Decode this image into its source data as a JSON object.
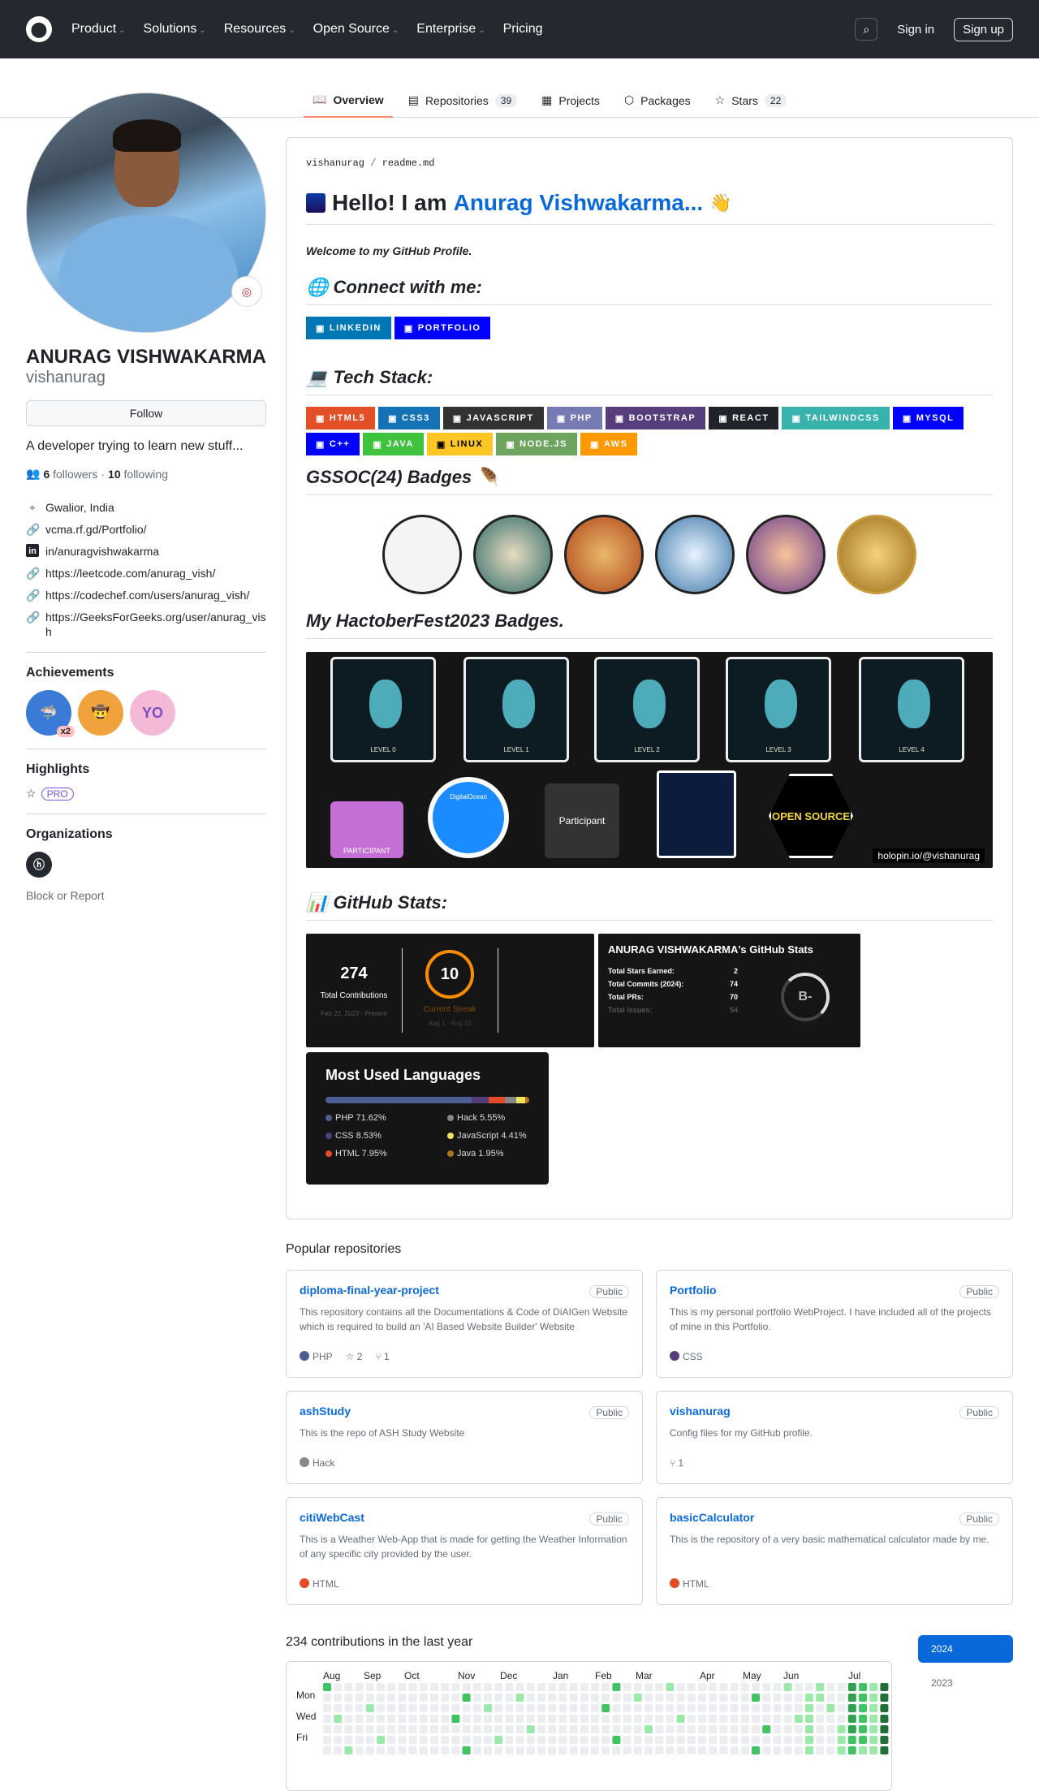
{
  "header": {
    "nav": [
      "Product",
      "Solutions",
      "Resources",
      "Open Source",
      "Enterprise",
      "Pricing"
    ],
    "signin": "Sign in",
    "signup": "Sign up"
  },
  "tabs": [
    {
      "label": "Overview"
    },
    {
      "label": "Repositories",
      "count": "39"
    },
    {
      "label": "Projects"
    },
    {
      "label": "Packages"
    },
    {
      "label": "Stars",
      "count": "22"
    }
  ],
  "profile": {
    "name": "ANURAG VISHWAKARMA",
    "login": "vishanurag",
    "follow": "Follow",
    "bio": "A developer trying to learn new stuff...",
    "followers": "6",
    "followers_label": "followers",
    "following": "10",
    "following_label": "following",
    "location": "Gwalior, India",
    "links": [
      "vcma.rf.gd/Portfolio/",
      "in/anuragvishwakarma",
      "https://leetcode.com/anurag_vish/",
      "https://codechef.com/users/anurag_vish/",
      "https://GeeksForGeeks.org/user/anurag_vish"
    ]
  },
  "sidebar": {
    "achievements": "Achievements",
    "ach_x2": "x2",
    "highlights": "Highlights",
    "pro": "PRO",
    "organizations": "Organizations",
    "block": "Block or Report"
  },
  "readme": {
    "owner": "vishanurag",
    "sep": "/",
    "file": "readme.md",
    "hello": "Hello! I am",
    "name_link": "Anurag Vishwakarma...",
    "wave": "👋",
    "welcome": "Welcome to my GitHub Profile.",
    "connect": "🌐 Connect with me:",
    "tech": "💻 Tech Stack:",
    "gssoc": "GSSOC(24) Badges 🪶",
    "hacto": "My HactoberFest2023 Badges.",
    "stats": "📊 GitHub Stats:",
    "connect_badges": [
      {
        "label": "LINKEDIN",
        "color": "#0077b5"
      },
      {
        "label": "PORTFOLIO",
        "color": "#0000ff"
      }
    ],
    "tech_badges": [
      {
        "label": "HTML5",
        "color": "#e34f26"
      },
      {
        "label": "CSS3",
        "color": "#1572b6"
      },
      {
        "label": "JAVASCRIPT",
        "color": "#323330"
      },
      {
        "label": "PHP",
        "color": "#777bb4"
      },
      {
        "label": "BOOTSTRAP",
        "color": "#563d7c"
      },
      {
        "label": "REACT",
        "color": "#20232a"
      },
      {
        "label": "TAILWINDCSS",
        "color": "#38b2ac"
      },
      {
        "label": "MYSQL",
        "color": "#0000ff"
      },
      {
        "label": "C++",
        "color": "#0000ff"
      },
      {
        "label": "JAVA",
        "color": "#3fc33f"
      },
      {
        "label": "LINUX",
        "color": "#fcc624",
        "dark": true
      },
      {
        "label": "NODE.JS",
        "color": "#6da55f"
      },
      {
        "label": "AWS",
        "color": "#ff9900"
      }
    ],
    "hacto_levels": [
      "LEVEL 0",
      "LEVEL 1",
      "LEVEL 2",
      "LEVEL 3",
      "LEVEL 4"
    ],
    "hacto_participant": "PARTICIPANT",
    "hacto_participant2": "Participant",
    "hacto_do": "DigitalOcean",
    "hacto_open": "OPEN SOURCE",
    "holopin": "holopin.io/@vishanurag",
    "streak": {
      "total": "274",
      "total_label": "Total Contributions",
      "total_range": "Feb 22, 2023 - Present",
      "current": "10",
      "current_label": "Current Streak",
      "current_range": "Aug 1 - Aug 10"
    },
    "ghstats": {
      "title": "ANURAG VISHWAKARMA's GitHub Stats",
      "rows": [
        {
          "k": "Total Stars Earned:",
          "v": "2"
        },
        {
          "k": "Total Commits (2024):",
          "v": "74"
        },
        {
          "k": "Total PRs:",
          "v": "70"
        },
        {
          "k": "Total Issues:",
          "v": "54"
        }
      ],
      "grade": "B-"
    },
    "langs": {
      "title": "Most Used Languages",
      "items": [
        {
          "name": "PHP 71.62%",
          "color": "#4f5d95",
          "pct": 71.62
        },
        {
          "name": "Hack 5.55%",
          "color": "#878787",
          "pct": 5.55
        },
        {
          "name": "CSS 8.53%",
          "color": "#563d7c",
          "pct": 8.53
        },
        {
          "name": "JavaScript 4.41%",
          "color": "#f1e05a",
          "pct": 4.41
        },
        {
          "name": "HTML 7.95%",
          "color": "#e34c26",
          "pct": 7.95
        },
        {
          "name": "Java 1.95%",
          "color": "#b07219",
          "pct": 1.95
        }
      ]
    }
  },
  "popular": {
    "title": "Popular repositories",
    "public": "Public",
    "repos": [
      {
        "name": "diploma-final-year-project",
        "desc": "This repository contains all the Documentations & Code of DiAIGen Website which is required to build an 'AI Based Website Builder' Website",
        "lang": "PHP",
        "color": "#4f5d95",
        "stars": "2",
        "forks": "1"
      },
      {
        "name": "Portfolio",
        "desc": "This is my personal portfolio WebProject. I have included all of the projects of mine in this Portfolio.",
        "lang": "CSS",
        "color": "#563d7c"
      },
      {
        "name": "ashStudy",
        "desc": "This is the repo of ASH Study Website",
        "lang": "Hack",
        "color": "#878787"
      },
      {
        "name": "vishanurag",
        "desc": "Config files for my GitHub profile.",
        "forks": "1"
      },
      {
        "name": "citiWebCast",
        "desc": "This is a Weather Web-App that is made for getting the Weather Information of any specific city provided by the user.",
        "lang": "HTML",
        "color": "#e34c26"
      },
      {
        "name": "basicCalculator",
        "desc": "This is the repository of a very basic mathematical calculator made by me.",
        "lang": "HTML",
        "color": "#e34c26"
      }
    ]
  },
  "contrib": {
    "title": "234 contributions in the last year",
    "months": [
      "Aug",
      "Sep",
      "Oct",
      "Nov",
      "Dec",
      "Jan",
      "Feb",
      "Mar",
      "Apr",
      "May",
      "Jun",
      "Jul"
    ],
    "days": [
      "Mon",
      "Wed",
      "Fri"
    ],
    "years": [
      "2024",
      "2023"
    ]
  }
}
